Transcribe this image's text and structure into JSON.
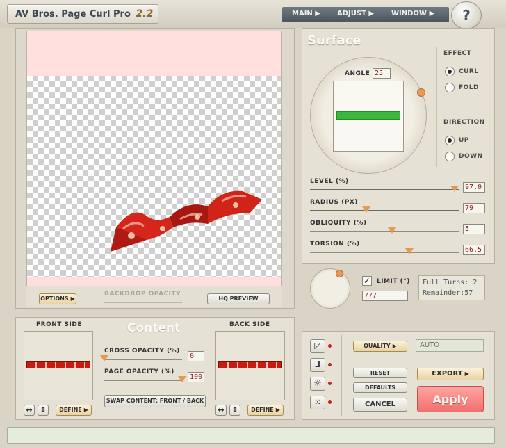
{
  "app": {
    "title": "AV Bros. Page Curl Pro",
    "version": "2.2"
  },
  "menu": {
    "main": "MAIN",
    "adjust": "ADJUST",
    "window": "WINDOW",
    "help": "?"
  },
  "preview": {
    "options": "OPTIONS",
    "backdrop_opacity": "BACKDROP OPACITY",
    "hq_preview": "HQ PREVIEW"
  },
  "surface": {
    "title": "Surface",
    "angle_label": "ANGLE",
    "angle_value": "25",
    "effect": {
      "title": "EFFECT",
      "curl": "CURL",
      "fold": "FOLD",
      "selected": "curl"
    },
    "direction": {
      "title": "DIRECTION",
      "up": "UP",
      "down": "DOWN",
      "selected": "up"
    },
    "sliders": [
      {
        "label": "LEVEL (%)",
        "value": "97.0",
        "fraction": 0.97
      },
      {
        "label": "RADIUS (PX)",
        "value": "79",
        "fraction": 0.38
      },
      {
        "label": "OBLIQUITY (%)",
        "value": "5",
        "fraction": 0.55
      },
      {
        "label": "TORSION (%)",
        "value": "66.5",
        "fraction": 0.67
      }
    ],
    "limit_label": "LIMIT (°)",
    "limit_value": "777",
    "limit_checked": true,
    "turns": {
      "full": "Full Turns:  2",
      "remainder": "Remainder:57"
    }
  },
  "content": {
    "title": "Content",
    "front_side": "FRONT SIDE",
    "back_side": "BACK SIDE",
    "cross_opacity_label": "CROSS OPACITY (%)",
    "cross_opacity_value": "0",
    "cross_fraction": 0.0,
    "page_opacity_label": "PAGE OPACITY (%)",
    "page_opacity_value": "100",
    "page_fraction": 1.0,
    "swap": "SWAP CONTENT: FRONT / BACK",
    "define": "DEFINE",
    "flip_h": "↔",
    "flip_v": "↕"
  },
  "actions": {
    "quality": "QUALITY",
    "quality_value": "AUTO",
    "reset": "RESET",
    "defaults": "DEFAULTS",
    "cancel": "CANCEL",
    "export": "EXPORT",
    "apply": "Apply"
  },
  "colors": {
    "accent": "#e8995a",
    "apply": "#f07a78",
    "ribbon": "#c41d14",
    "preview_bg": "#ffe0df"
  }
}
